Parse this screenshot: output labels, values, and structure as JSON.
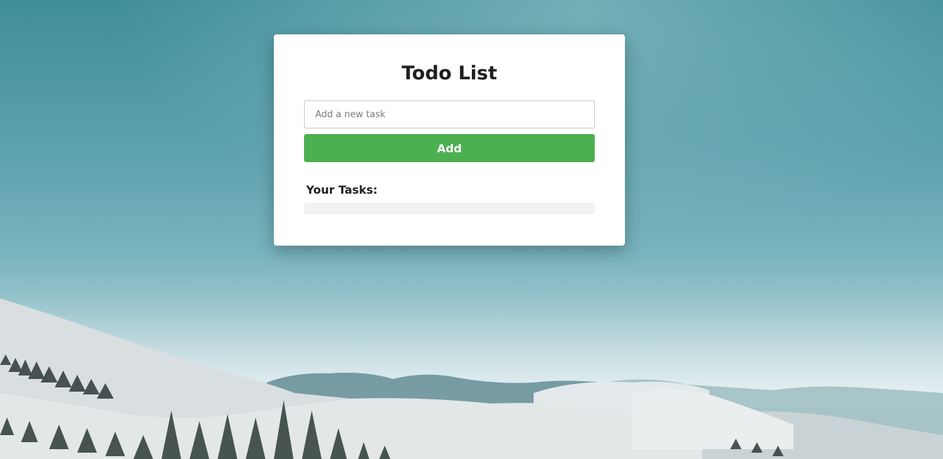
{
  "app": {
    "title": "Todo List"
  },
  "form": {
    "input_value": "",
    "input_placeholder": "Add a new task",
    "add_label": "Add"
  },
  "tasks": {
    "heading": "Your Tasks:",
    "items": []
  },
  "colors": {
    "accent": "#4caf50",
    "card_background": "#ffffff",
    "task_list_background": "#f2f2f2"
  }
}
